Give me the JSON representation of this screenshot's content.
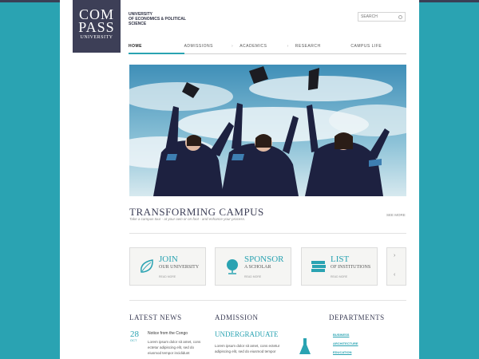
{
  "logo": {
    "line1": "COM",
    "line2": "PASS",
    "line3": "UNIVERSITY"
  },
  "university": {
    "line1": "University",
    "line2": "of Economics & Political",
    "line3": "Science"
  },
  "search": {
    "placeholder": "SEARCH"
  },
  "nav": {
    "items": [
      {
        "label": "HOME",
        "arrow": ""
      },
      {
        "label": "ADMISSIONS",
        "arrow": "›"
      },
      {
        "label": "ACADEMICS",
        "arrow": "›"
      },
      {
        "label": "RESEARCH",
        "arrow": ""
      },
      {
        "label": "CAMPUS LIFE",
        "arrow": ""
      }
    ]
  },
  "hero": {
    "title": "TRANSFORMING CAMPUS",
    "subtitle": "Take a campus tour - at your own or on foot - and enhance your process.",
    "see_more": "SEE MORE"
  },
  "boxes": [
    {
      "heading": "JOIN",
      "sub": "OUR UNIVERSITY",
      "link": "READ MORE",
      "icon": "leaf-icon"
    },
    {
      "heading": "SPONSOR",
      "sub": "A SCHOLAR",
      "link": "READ MORE",
      "icon": "globe-icon"
    },
    {
      "heading": "LIST",
      "sub": "OF INSTITUTIONS",
      "link": "READ MORE",
      "icon": "books-icon"
    }
  ],
  "arrows": {
    "up": "›",
    "down": "‹"
  },
  "news": {
    "heading": "LATEST NEWS",
    "day": "28",
    "month": "OCT",
    "title": "Notice from the Congo",
    "text": "Lorem ipsum dolor sit amet, cons ectetur adipiscing elit, sed do eiusmod tempor incididunt"
  },
  "admission": {
    "heading": "ADMISSION",
    "subheading": "UNDERGRADUATE",
    "text": "Lorem ipsum dolor sit amet, cons ectetur adipiscing elit, sed do eiusmod tempor"
  },
  "departments": {
    "heading": "DEPARTMENTS",
    "items": [
      "BUSINESS",
      "ARCHITECTURE",
      "EDUCATION"
    ]
  },
  "colors": {
    "accent": "#2aa3b2",
    "brand": "#3d3f57",
    "background": "#2aa3b2"
  }
}
